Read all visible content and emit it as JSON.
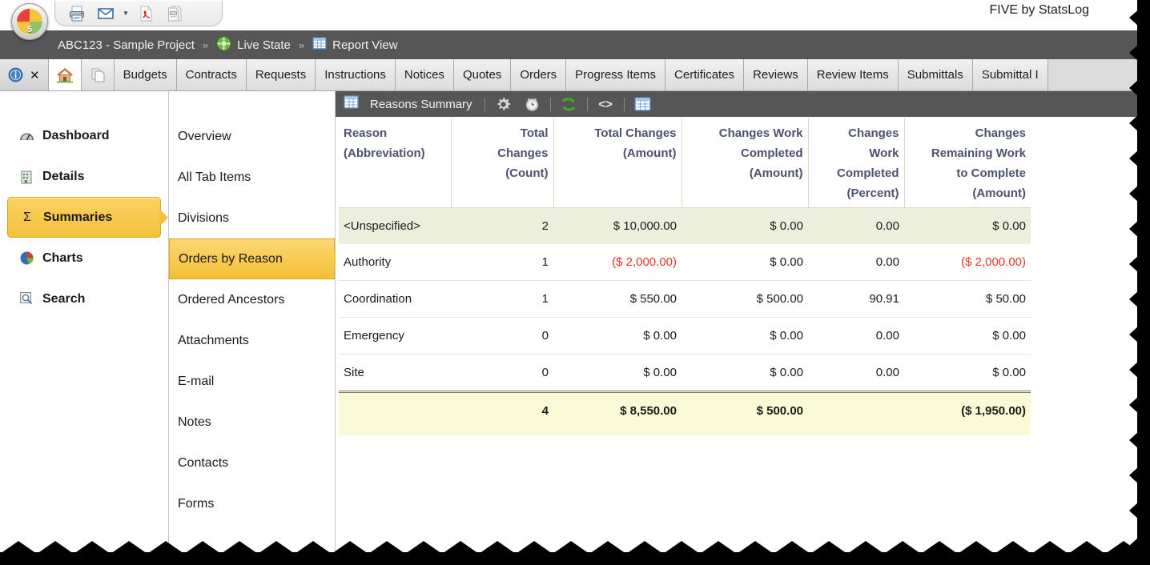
{
  "app": {
    "title": "FIVE by StatsLog",
    "orb_number": "5"
  },
  "quick_access": {
    "buttons": [
      {
        "name": "print-icon",
        "label": "Print"
      },
      {
        "name": "email-icon",
        "label": "E-mail"
      },
      {
        "name": "email-dropdown-caret-icon",
        "label": "▾"
      },
      {
        "name": "pdf-icon",
        "label": "Export PDF"
      },
      {
        "name": "report-export-icon",
        "label": "Export Report"
      }
    ]
  },
  "breadcrumb": {
    "project": "ABC123 - Sample Project",
    "separator": "»",
    "state": "Live State",
    "view": "Report View"
  },
  "tabs": {
    "system": [
      {
        "name": "tab-info",
        "label": ""
      },
      {
        "name": "tab-close",
        "label": "✕"
      }
    ],
    "home_label": "",
    "copy_label": "",
    "items": [
      "Budgets",
      "Contracts",
      "Requests",
      "Instructions",
      "Notices",
      "Quotes",
      "Orders",
      "Progress Items",
      "Certificates",
      "Reviews",
      "Review Items",
      "Submittals",
      "Submittal I"
    ]
  },
  "nav": {
    "items": [
      {
        "label": "Dashboard",
        "icon": "gauge-icon",
        "active": false
      },
      {
        "label": "Details",
        "icon": "building-icon",
        "active": false
      },
      {
        "label": "Summaries",
        "icon": "sigma-icon",
        "active": true
      },
      {
        "label": "Charts",
        "icon": "pie-chart-icon",
        "active": false
      },
      {
        "label": "Search",
        "icon": "magnifier-icon",
        "active": false
      }
    ]
  },
  "sublist": {
    "items": [
      {
        "label": "Overview",
        "active": false
      },
      {
        "label": "All Tab Items",
        "active": false
      },
      {
        "label": "Divisions",
        "active": false
      },
      {
        "label": "Orders by Reason",
        "active": true
      },
      {
        "label": "Ordered Ancestors",
        "active": false
      },
      {
        "label": "Attachments",
        "active": false
      },
      {
        "label": "E-mail",
        "active": false
      },
      {
        "label": "Notes",
        "active": false
      },
      {
        "label": "Contacts",
        "active": false
      },
      {
        "label": "Forms",
        "active": false
      }
    ]
  },
  "report": {
    "toolbar": {
      "title": "Reasons Summary",
      "buttons": [
        {
          "name": "grid-icon",
          "label": "Reasons Summary"
        },
        {
          "name": "gear-icon",
          "label": "Settings"
        },
        {
          "name": "clock-icon",
          "label": "History"
        },
        {
          "name": "refresh-icon",
          "label": "Refresh"
        },
        {
          "name": "code-icon",
          "label": "<>"
        },
        {
          "name": "table-view-icon",
          "label": "Table View"
        }
      ]
    },
    "columns": [
      "Reason\n(Abbreviation)",
      "Total\nChanges\n(Count)",
      "Total Changes\n(Amount)",
      "Changes Work\nCompleted\n(Amount)",
      "Changes\nWork\nCompleted\n(Percent)",
      "Changes\nRemaining Work\nto Complete\n(Amount)"
    ],
    "rows": [
      {
        "reason": "<Unspecified>",
        "total_changes_count": "2",
        "total_changes_amount": "$ 10,000.00",
        "work_completed_amount": "$ 0.00",
        "work_completed_percent": "0.00",
        "remaining_work_amount": "$ 0.00",
        "highlight": true,
        "negatives": []
      },
      {
        "reason": "Authority",
        "total_changes_count": "1",
        "total_changes_amount": "($ 2,000.00)",
        "work_completed_amount": "$ 0.00",
        "work_completed_percent": "0.00",
        "remaining_work_amount": "($ 2,000.00)",
        "highlight": false,
        "negatives": [
          "total_changes_amount",
          "remaining_work_amount"
        ]
      },
      {
        "reason": "Coordination",
        "total_changes_count": "1",
        "total_changes_amount": "$ 550.00",
        "work_completed_amount": "$ 500.00",
        "work_completed_percent": "90.91",
        "remaining_work_amount": "$ 50.00",
        "highlight": false,
        "negatives": []
      },
      {
        "reason": "Emergency",
        "total_changes_count": "0",
        "total_changes_amount": "$ 0.00",
        "work_completed_amount": "$ 0.00",
        "work_completed_percent": "0.00",
        "remaining_work_amount": "$ 0.00",
        "highlight": false,
        "negatives": []
      },
      {
        "reason": "Site",
        "total_changes_count": "0",
        "total_changes_amount": "$ 0.00",
        "work_completed_amount": "$ 0.00",
        "work_completed_percent": "0.00",
        "remaining_work_amount": "$ 0.00",
        "highlight": false,
        "negatives": []
      }
    ],
    "total_row": {
      "reason": "",
      "total_changes_count": "4",
      "total_changes_amount": "$ 8,550.00",
      "work_completed_amount": "$ 500.00",
      "work_completed_percent": "",
      "remaining_work_amount": "($ 1,950.00)"
    }
  },
  "colors": {
    "accent_gold": "#f4bf36",
    "chrome_dark": "#565656",
    "header_text": "#4c5270",
    "negative": "#e8372a",
    "row_highlight": "#ecefdb",
    "total_highlight": "#fbfad6"
  }
}
